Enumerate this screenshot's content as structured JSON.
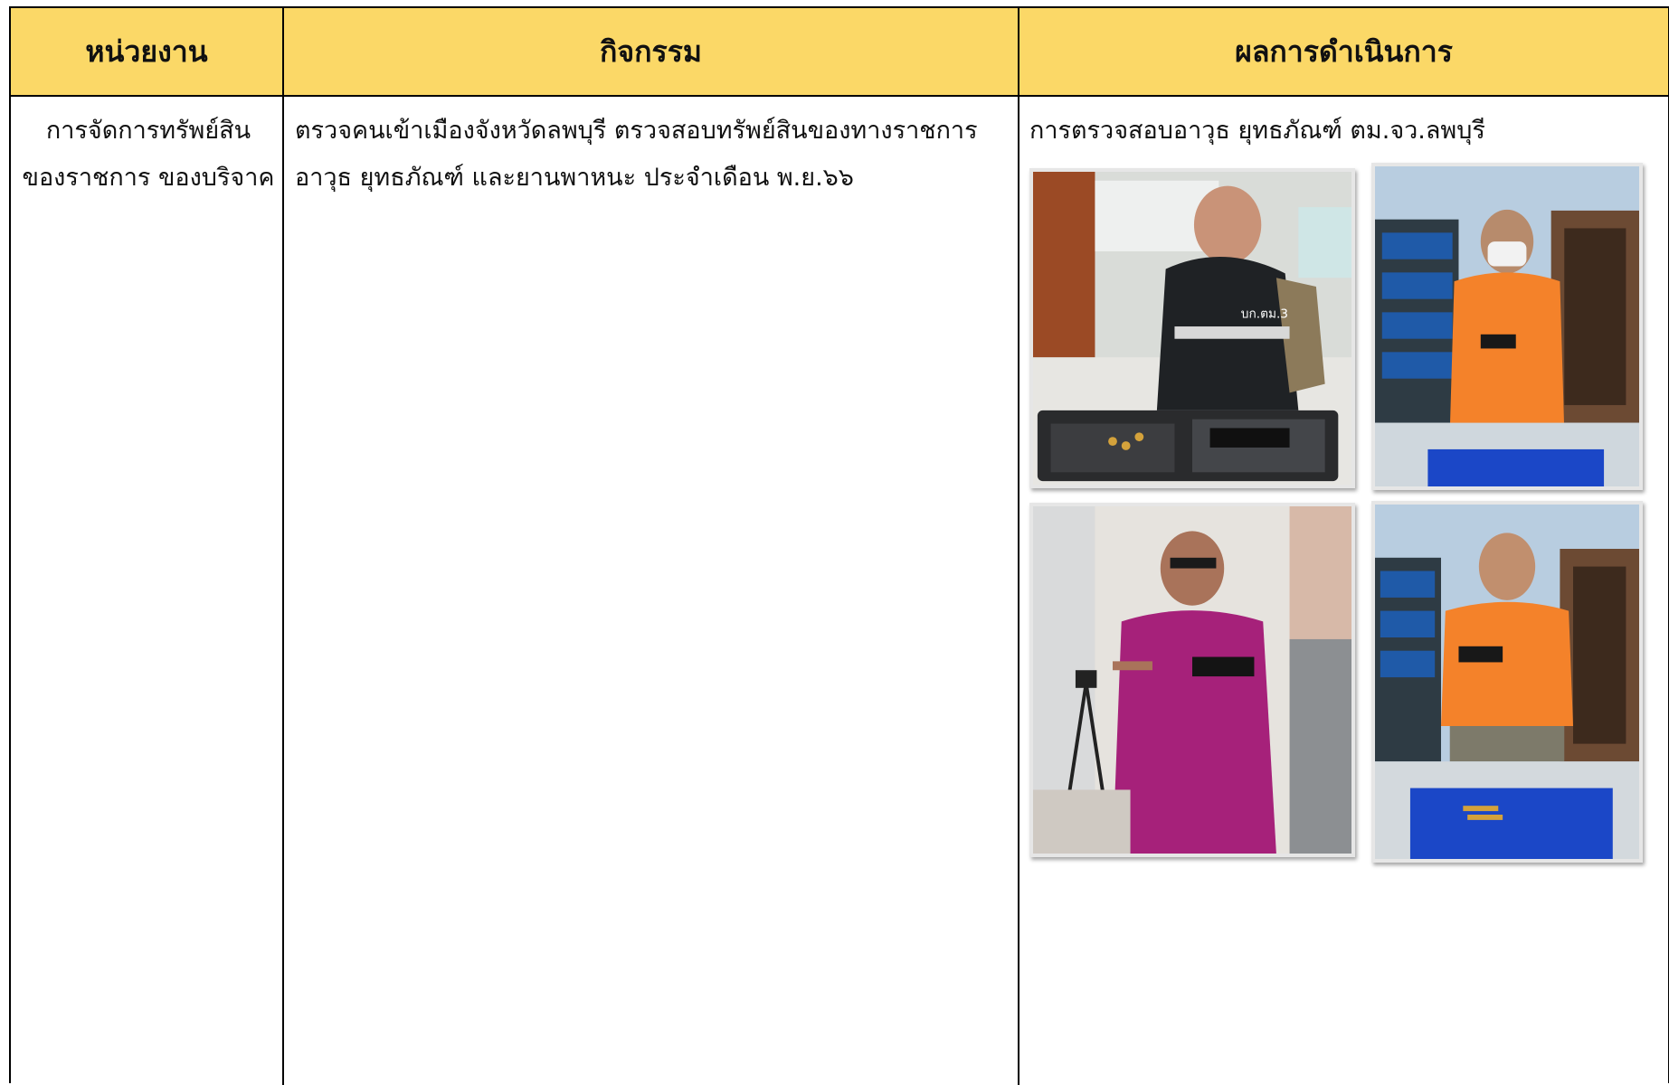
{
  "table": {
    "headers": {
      "unit": "หน่วยงาน",
      "activity": "กิจกรรม",
      "result": "ผลการดำเนินการ"
    },
    "row": {
      "unit_line1": "การจัดการทรัพย์สิน",
      "unit_line2": "ของราชการ ของบริจาค",
      "activity_line1": "ตรวจคนเข้าเมืองจังหวัดลพบุรี ตรวจสอบทรัพย์สินของทางราชการ",
      "activity_line2": "อาวุธ ยุทธภัณฑ์ และยานพาหนะ ประจำเดือน พ.ย.๖๖",
      "result_line1": "การตรวจสอบอาวุธ ยุทธภัณฑ์ ตม.จว.ลพบุรี"
    }
  },
  "colors": {
    "header_bg": "#fbd867",
    "grid_line": "#000000"
  },
  "photos": {
    "p1_badge_text": "บก.ตม.3"
  }
}
